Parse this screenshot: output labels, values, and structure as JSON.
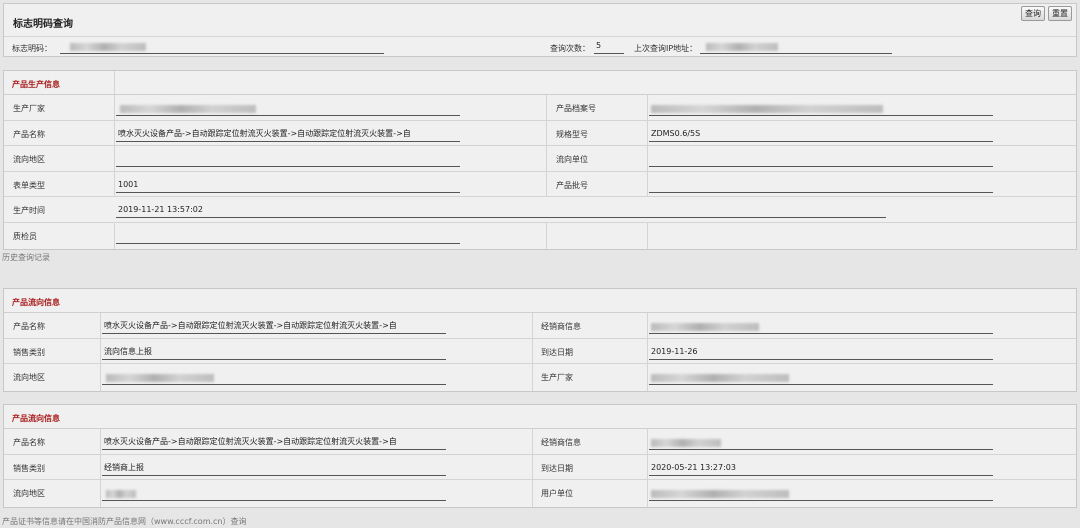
{
  "header": {
    "title": "标志明码查询",
    "query_button": "查询",
    "reset_button": "重置"
  },
  "search": {
    "code_label": "标志明码：",
    "count_label": "查询次数：",
    "count_value": "5",
    "ip_label": "上次查询IP地址："
  },
  "production": {
    "title": "产品生产信息",
    "manufacturer_label": "生产厂家",
    "archive_no_label": "产品档案号",
    "product_name_label": "产品名称",
    "product_name_value": "喷水灭火设备产品->自动跟踪定位射流灭火装置->自动跟踪定位射流灭火装置->自",
    "model_label": "规格型号",
    "model_value": "ZDMS0.6/5S",
    "region_label": "流向地区",
    "unit_label": "流向单位",
    "form_type_label": "表单类型",
    "form_type_value": "1001",
    "batch_label": "产品批号",
    "time_label": "生产时间",
    "time_value": "2019-11-21 13:57:02",
    "inspector_label": "质检员"
  },
  "history_label": "历史查询记录",
  "flow1": {
    "title": "产品流向信息",
    "product_name_label": "产品名称",
    "product_name_value": "喷水灭火设备产品->自动跟踪定位射流灭火装置->自动跟踪定位射流灭火装置->自",
    "dealer_label": "经销商信息",
    "sale_type_label": "销售类别",
    "sale_type_value": "流向信息上报",
    "arrival_label": "到达日期",
    "arrival_value": "2019-11-26",
    "region_label": "流向地区",
    "maker_label": "生产厂家"
  },
  "flow2": {
    "title": "产品流向信息",
    "product_name_label": "产品名称",
    "product_name_value": "喷水灭火设备产品->自动跟踪定位射流灭火装置->自动跟踪定位射流灭火装置->自",
    "dealer_label": "经销商信息",
    "sale_type_label": "销售类别",
    "sale_type_value": "经销商上报",
    "arrival_label": "到达日期",
    "arrival_value": "2020-05-21 13:27:03",
    "region_label": "流向地区",
    "user_unit_label": "用户单位"
  },
  "footer_note": "产品证书等信息请在中国消防产品信息网（www.cccf.com.cn）查询",
  "colors": {
    "section_title": "#a81a1a",
    "background": "#e6e6e6",
    "panel": "#f0f0f0"
  }
}
